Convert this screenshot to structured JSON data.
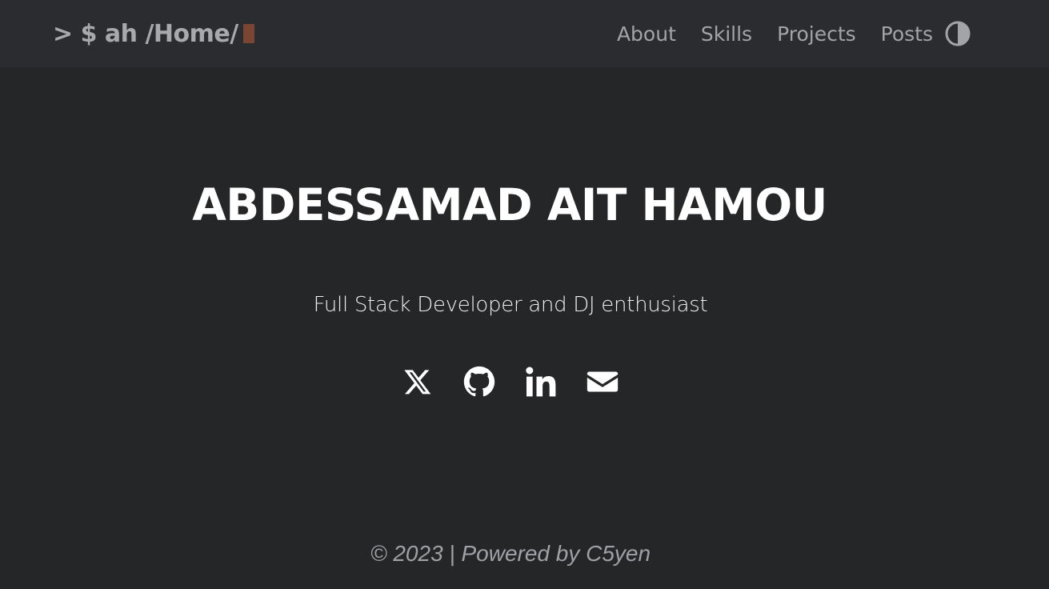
{
  "header": {
    "logo_text": "> $ ah /Home/",
    "nav": [
      {
        "label": "About"
      },
      {
        "label": "Skills"
      },
      {
        "label": "Projects"
      },
      {
        "label": "Posts"
      }
    ],
    "theme_toggle_icon": "contrast-icon"
  },
  "hero": {
    "name": "ABDESSAMAD AIT HAMOU",
    "tagline": "Full Stack Developer and DJ enthusiast"
  },
  "social": [
    {
      "icon": "x-twitter-icon"
    },
    {
      "icon": "github-icon"
    },
    {
      "icon": "linkedin-icon"
    },
    {
      "icon": "email-icon"
    }
  ],
  "footer": {
    "text": "© 2023 | Powered by C5yen"
  },
  "colors": {
    "background": "#252628",
    "header_background": "#2b2c2f",
    "cursor": "#7a4634",
    "text_primary": "#ffffff",
    "text_muted": "#a3a4a8"
  }
}
